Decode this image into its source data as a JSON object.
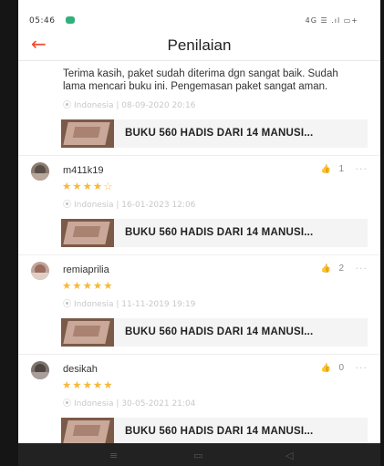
{
  "status_bar": {
    "time": "05:46",
    "icons": "4G  ☰ .ıl  ▭+"
  },
  "header": {
    "back_icon": "arrow-left-icon",
    "title": "Penilaian",
    "accent": "#ee4d2d"
  },
  "reviews": [
    {
      "comment": "Terima kasih, paket sudah diterima dgn sangat baik. Sudah lama mencari buku ini. Pengemasan paket sangat aman.",
      "meta": "Indonesia | 08-09-2020 20:16",
      "product": "BUKU 560 HADIS DARI 14 MANUSI..."
    },
    {
      "username": "m411k19",
      "likes": "1",
      "rating": 4,
      "stars": "★★★★",
      "stars_empty": "☆",
      "meta": "Indonesia | 16-01-2023 12:06",
      "product": "BUKU 560 HADIS DARI 14 MANUSI..."
    },
    {
      "username": "remiaprilia",
      "likes": "2",
      "rating": 5,
      "stars": "★★★★★",
      "meta": "Indonesia | 11-11-2019 19:19",
      "product": "BUKU 560 HADIS DARI 14 MANUSI..."
    },
    {
      "username": "desikah",
      "likes": "0",
      "rating": 5,
      "stars": "★★★★★",
      "meta": "Indonesia | 30-05-2021 21:04",
      "product": "BUKU 560 HADIS DARI 14 MANUSI..."
    }
  ],
  "navbar": {
    "menu": "≡",
    "home": "▭",
    "back": "◁"
  },
  "colors": {
    "star": "#f6b93b",
    "text": "#222222",
    "meta": "#c8c8c8"
  }
}
